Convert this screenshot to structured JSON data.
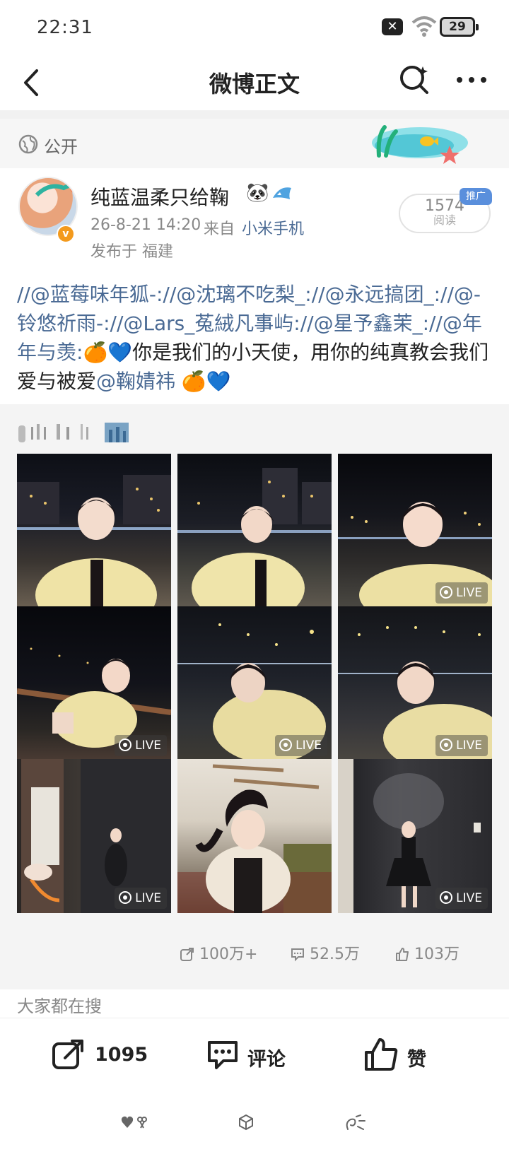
{
  "status_bar": {
    "time": "22:31",
    "battery": "29"
  },
  "nav": {
    "title": "微博正文"
  },
  "visibility": {
    "label": "公开"
  },
  "author": {
    "name": "纯蓝温柔只给鞠",
    "name_emoji": "🐼",
    "time": "26-8-21 14:20",
    "from_label": "来自",
    "device": "小米手机",
    "location": "发布于 福建",
    "reads_count": "1574",
    "reads_label": "阅读",
    "promo_tag": "推广"
  },
  "content": {
    "mentions_1": "//@蓝莓味年狐-://@沈璃不吃梨_://@永远搞团_://@-铃悠祈雨-://@Lars_菟絨凡事屿://@星予鑫茉_://@年年与羡:",
    "emoji_1": "🍊💙",
    "text": "你是我们的小天使，用你的纯真教会我们爱与被爱",
    "mention_final": "@鞠婧祎",
    "emoji_2": " 🍊💙"
  },
  "repost": {
    "images": [
      {
        "live": false,
        "live_label": ""
      },
      {
        "live": false,
        "live_label": ""
      },
      {
        "live": true,
        "live_label": "LIVE"
      },
      {
        "live": true,
        "live_label": "LIVE"
      },
      {
        "live": true,
        "live_label": "LIVE"
      },
      {
        "live": true,
        "live_label": "LIVE"
      },
      {
        "live": true,
        "live_label": "LIVE"
      },
      {
        "live": false,
        "live_label": ""
      },
      {
        "live": true,
        "live_label": "LIVE"
      }
    ],
    "stats": {
      "reposts": "100万+",
      "comments": "52.5万",
      "likes": "103万"
    }
  },
  "hot_search": {
    "label": "大家都在搜"
  },
  "actions": {
    "share_count": "1095",
    "comment_label": "评论",
    "like_label": "赞"
  },
  "colors": {
    "link": "#4a6a94",
    "muted": "#888888",
    "accent_orange": "#f39a1d"
  }
}
